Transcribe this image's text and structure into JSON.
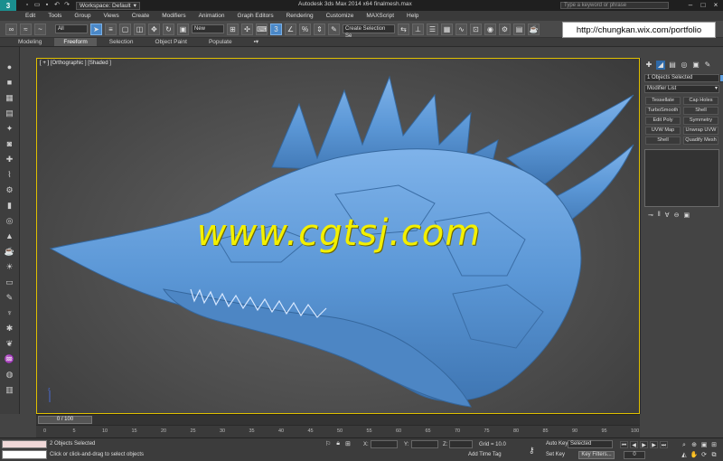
{
  "titlebar": {
    "app_logo": "3",
    "workspace_label": "Workspace: Default",
    "window_title": "Autodesk 3ds Max  2014 x64     finalmesh.max",
    "search_placeholder": "Type a keyword or phrase"
  },
  "menu": [
    "Edit",
    "Tools",
    "Group",
    "Views",
    "Create",
    "Modifiers",
    "Animation",
    "Graph Editors",
    "Rendering",
    "Customize",
    "MAXScript",
    "Help"
  ],
  "toolbar": {
    "filter_value": "All",
    "layer_value": "New",
    "selection_set_value": "Create Selection Se"
  },
  "ribbon_tabs": [
    "Modeling",
    "Freeform",
    "Selection",
    "Object Paint",
    "Populate"
  ],
  "ribbon_active": "Freeform",
  "url_banner": "http://chungkan.wix.com/portfolio",
  "viewport": {
    "label_plus": "[ + ]",
    "label_view": "[Orthographic ]",
    "label_shading": "[Shaded ]",
    "watermark": "www.cgtsj.com",
    "model_color": "#5b97d6"
  },
  "command_panel": {
    "object_name": "1 Objects Selected",
    "modifier_list": "Modifier List",
    "modifiers": [
      "Tessellate",
      "Cap Holes",
      "TurboSmooth",
      "Shell",
      "Edit Poly",
      "Symmetry",
      "UVW Map",
      "Unwrap UVW",
      "Shell",
      "Quadify Mesh"
    ]
  },
  "timeline": {
    "slider_label": "0 / 100",
    "ticks": [
      "0",
      "5",
      "10",
      "15",
      "20",
      "25",
      "30",
      "35",
      "40",
      "45",
      "50",
      "55",
      "60",
      "65",
      "70",
      "75",
      "80",
      "85",
      "90",
      "95",
      "100"
    ]
  },
  "status": {
    "selected": "2 Objects Selected",
    "prompt": "Click or click-and-drag to select objects",
    "x_label": "X:",
    "y_label": "Y:",
    "z_label": "Z:",
    "grid": "Grid = 10.0",
    "add_time_tag": "Add Time Tag",
    "auto_key": "Auto Key",
    "auto_key_value": "Selected",
    "set_key": "Set Key",
    "key_filters": "Key Filters...",
    "frame": "0"
  }
}
